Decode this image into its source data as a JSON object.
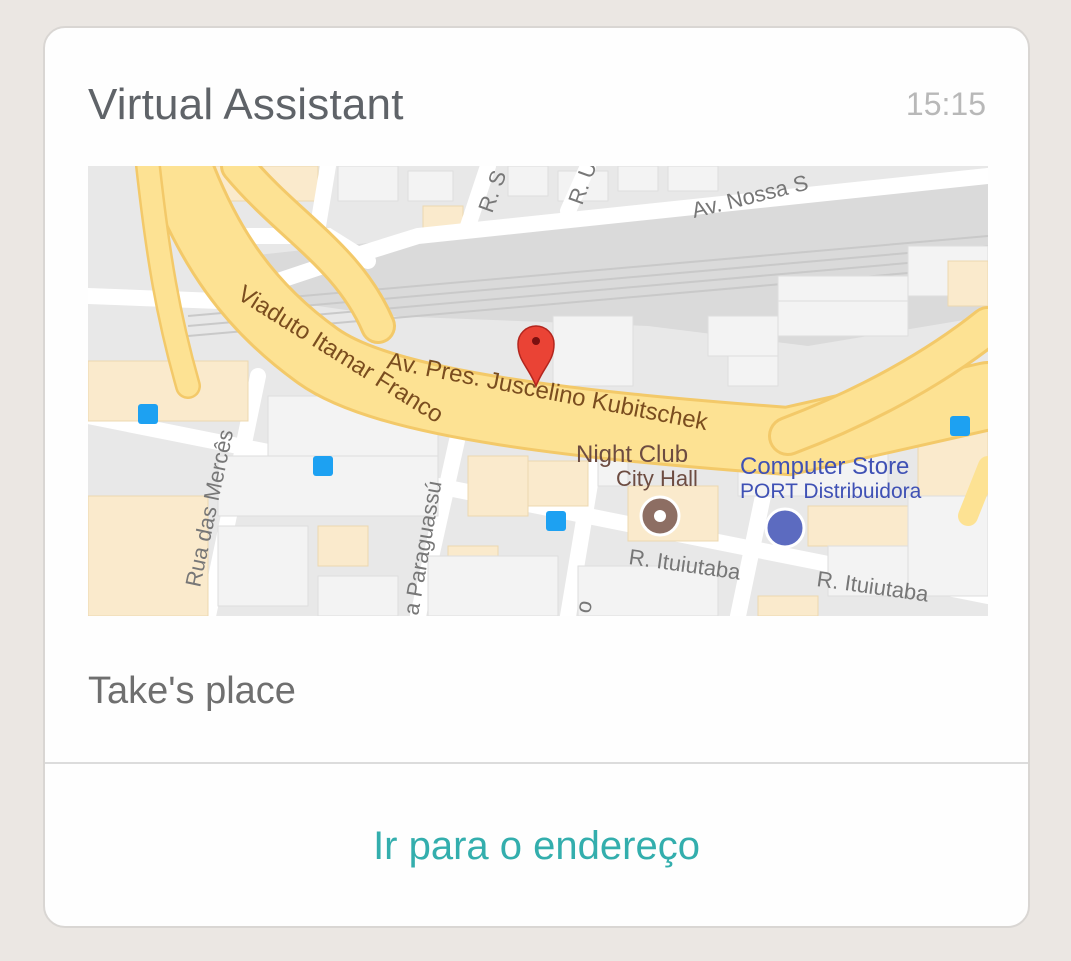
{
  "message": {
    "sender": "Virtual Assistant",
    "time": "15:15",
    "caption": "Take's place",
    "action_label": "Ir para o endereço"
  },
  "map": {
    "streets": {
      "main_avenue": "Av. Pres. Juscelino Kubitschek",
      "viaduct": "Viaduto Itamar Franco",
      "top_avenue": "Av. Nossa S",
      "street_left": "Rua das Mercês",
      "street_middle": "a Paraguassú",
      "itu_1": "R. Ituiutaba",
      "itu_2": "R. Ituiutaba",
      "small_1": "R. S",
      "small_2": "R. U",
      "bottom_cut": "o"
    },
    "places": {
      "night_club": "Night Club",
      "city_hall": "City Hall",
      "computer_store": "Computer Store",
      "port": "PORT Distribuidora"
    },
    "colors": {
      "road_major": "#fde293",
      "road_major_border": "#f3c969",
      "building_tan": "#faeacc",
      "background": "#e8e8e8",
      "transit_blue": "#1da1f2",
      "pin_red": "#ea4335",
      "store_label": "#3f51b5",
      "poi_brown": "#8d6e63"
    }
  }
}
